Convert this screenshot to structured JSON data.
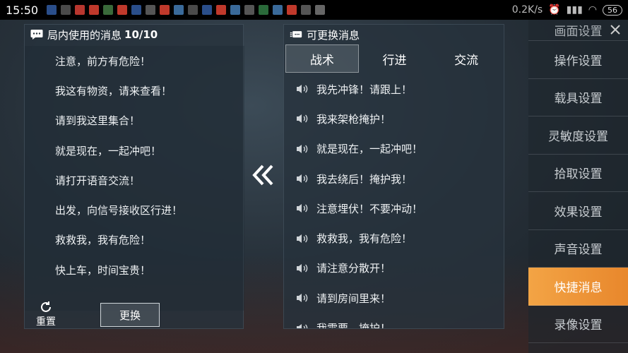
{
  "status_bar": {
    "time": "15:50",
    "network_speed": "0.2K/s",
    "battery": "56"
  },
  "left_panel": {
    "title": "局内使用的消息",
    "count": "10/10",
    "messages": [
      "注意，前方有危险！",
      "我这有物资，请来查看！",
      "请到我这里集合！",
      "就是现在，一起冲吧！",
      "请打开语音交流！",
      "出发，向信号接收区行进！",
      "救救我，我有危险！",
      "快上车，时间宝贵！"
    ],
    "reset_label": "重置",
    "replace_label": "更换"
  },
  "right_panel": {
    "title": "可更换消息",
    "tabs": [
      "战术",
      "行进",
      "交流"
    ],
    "active_tab": 0,
    "messages": [
      "我先冲锋！请跟上！",
      "我来架枪掩护！",
      "就是现在，一起冲吧！",
      "我去绕后！掩护我！",
      "注意埋伏！不要冲动！",
      "救救我，我有危险！",
      "请注意分散开！",
      "请到房间里来！",
      "我需要…掩护！"
    ]
  },
  "sidebar": {
    "top_partial": "画面设置",
    "items": [
      "操作设置",
      "载具设置",
      "灵敏度设置",
      "拾取设置",
      "效果设置",
      "声音设置",
      "快捷消息",
      "录像设置"
    ],
    "active_index": 6
  },
  "colors": {
    "accent": "#ef9a3c",
    "panel_bg": "#26323c"
  }
}
